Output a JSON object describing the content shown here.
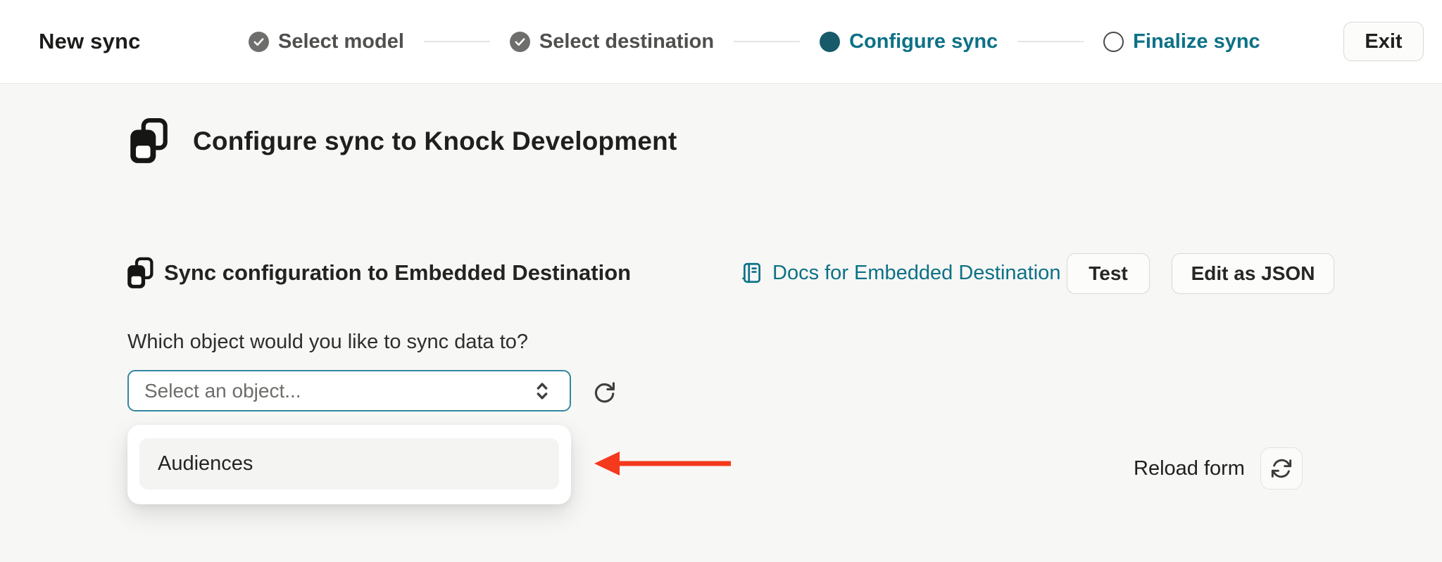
{
  "header": {
    "title": "New sync",
    "exit_button": "Exit",
    "steps": [
      {
        "label": "Select model",
        "state": "complete"
      },
      {
        "label": "Select destination",
        "state": "complete"
      },
      {
        "label": "Configure sync",
        "state": "current"
      },
      {
        "label": "Finalize sync",
        "state": "upcoming"
      }
    ]
  },
  "main": {
    "page_heading": "Configure sync to Knock Development",
    "config_section": {
      "heading": "Sync configuration to Embedded Destination",
      "docs_link_label": "Docs for Embedded Destination",
      "test_button_label": "Test",
      "edit_json_button_label": "Edit as JSON"
    },
    "object_field": {
      "question": "Which object would you like to sync data to?",
      "select_placeholder": "Select an object...",
      "options": [
        {
          "label": "Audiences"
        }
      ]
    },
    "reload_form_label": "Reload form"
  },
  "colors": {
    "accent_teal": "#0d7186",
    "step_current_circle": "#175a6a",
    "annotation_arrow_red": "#f5391c",
    "page_background": "#f7f7f5"
  }
}
